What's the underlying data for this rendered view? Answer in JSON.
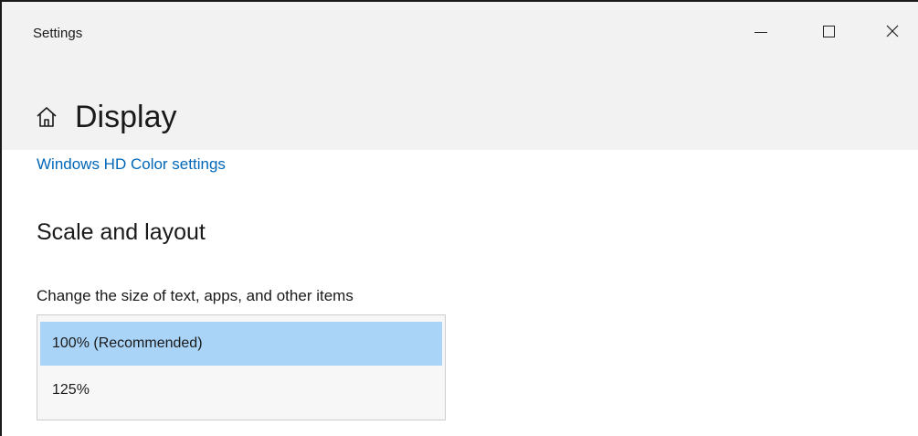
{
  "window": {
    "title": "Settings",
    "controls": {
      "minimize": "minimize",
      "maximize": "maximize",
      "close": "close"
    }
  },
  "header": {
    "page_title": "Display",
    "home_icon": "home-icon"
  },
  "content": {
    "hd_color_link": "Windows HD Color settings",
    "section_heading": "Scale and layout",
    "scale_label": "Change the size of text, apps, and other items",
    "scale_options": [
      {
        "label": "100% (Recommended)",
        "selected": true
      },
      {
        "label": "125%",
        "selected": false
      }
    ]
  },
  "colors": {
    "accent_link": "#0067b8",
    "selected_option": "#a9d4f8",
    "titlebar_bg": "#f2f2f2"
  }
}
